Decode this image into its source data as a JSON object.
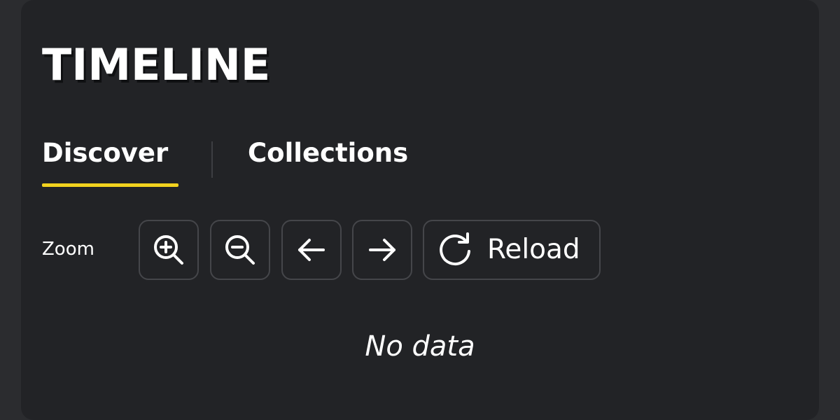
{
  "panel": {
    "title": "TIMELINE"
  },
  "tabs": [
    {
      "label": "Discover",
      "active": true
    },
    {
      "label": "Collections",
      "active": false
    }
  ],
  "toolbar": {
    "zoom_label": "Zoom",
    "buttons": [
      {
        "icon": "zoom-in-icon"
      },
      {
        "icon": "zoom-out-icon"
      },
      {
        "icon": "arrow-left-icon"
      },
      {
        "icon": "arrow-right-icon"
      },
      {
        "icon": "reload-icon",
        "label": "Reload"
      }
    ]
  },
  "empty_state": {
    "message": "No data"
  },
  "colors": {
    "background": "#222326",
    "accent": "#f2d21e",
    "text": "#ffffff",
    "border": "#45464a"
  }
}
